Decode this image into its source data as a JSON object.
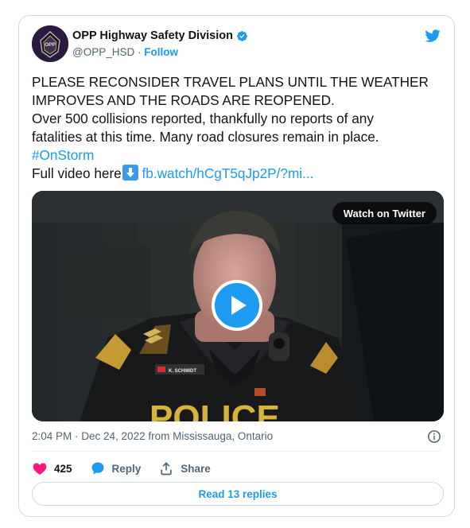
{
  "author": {
    "name": "OPP Highway Safety Division",
    "handle": "@OPP_HSD",
    "separator": "·",
    "follow_label": "Follow",
    "avatar_text": "OPP"
  },
  "tweet": {
    "line1": "PLEASE RECONSIDER TRAVEL PLANS UNTIL THE WEATHER",
    "line2": "IMPROVES AND THE ROADS ARE REOPENED.",
    "line3": "Over 500 collisions reported, thankfully no reports of any",
    "line4": "fatalities at this time. Many road closures remain in place.",
    "hashtag": "#OnStorm",
    "full_video_label": "Full video here",
    "link_text": "fb.watch/hCgT5qJp2P/?mi..."
  },
  "video": {
    "watch_label": "Watch on Twitter",
    "badge_name": "K. SCHMIDT",
    "vest_text": "POLICE"
  },
  "meta": {
    "timestamp": "2:04 PM · Dec 24, 2022 from Mississauga, Ontario"
  },
  "actions": {
    "like_count": "425",
    "reply_label": "Reply",
    "share_label": "Share"
  },
  "read_replies_label": "Read 13 replies",
  "colors": {
    "accent": "#1d9bf0",
    "like": "#f91880",
    "text": "#0f1419",
    "muted": "#536471"
  }
}
